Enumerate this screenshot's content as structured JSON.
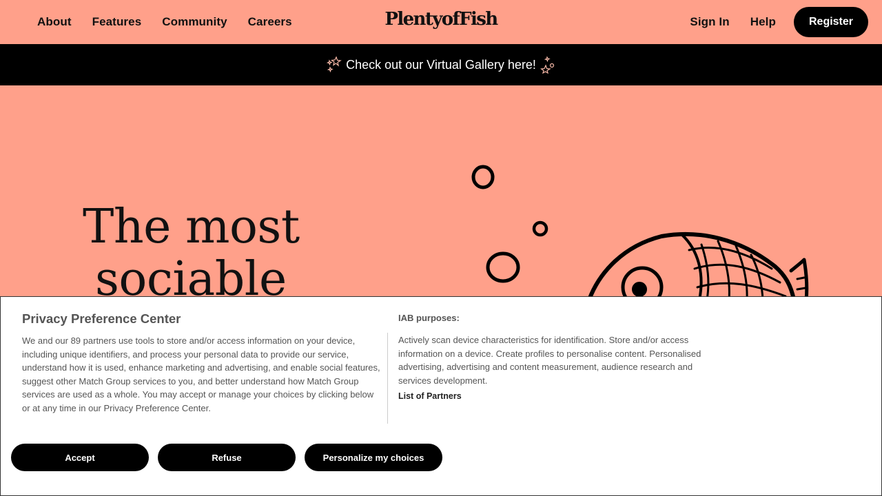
{
  "nav": {
    "left_links": [
      "About",
      "Features",
      "Community",
      "Careers"
    ],
    "logo_text": "PlentyofFish",
    "sign_in": "Sign In",
    "help": "Help",
    "register": "Register"
  },
  "banner": {
    "text": "Check out our Virtual Gallery here!"
  },
  "hero": {
    "title_line1": "The most",
    "title_line2": "sociable"
  },
  "privacy": {
    "title": "Privacy Preference Center",
    "body": "We and our 89 partners use tools to store and/or access information on your device, including unique identifiers, and process your personal data to provide our service, understand how it is used, enhance marketing and advertising, and enable social features, suggest other Match Group services to you, and better understand how Match Group services are used as a whole. You may accept or manage your choices by clicking below or at any time in our Privacy Preference Center.",
    "iab_heading": "IAB purposes:",
    "iab_body": "Actively scan device characteristics for identification. Store and/or access information on a device. Create profiles to personalise content. Personalised advertising, advertising and content measurement, audience research and services development.",
    "partners_link": "List of Partners",
    "buttons": {
      "accept": "Accept",
      "refuse": "Refuse",
      "personalize": "Personalize my choices"
    }
  },
  "colors": {
    "background": "#FFA08A",
    "banner_bg": "#000000",
    "button_bg": "#000000",
    "modal_bg": "#FFFFFF"
  },
  "icons": {
    "banner_left": "sparkle-icon",
    "banner_right": "sparkle-icon"
  }
}
